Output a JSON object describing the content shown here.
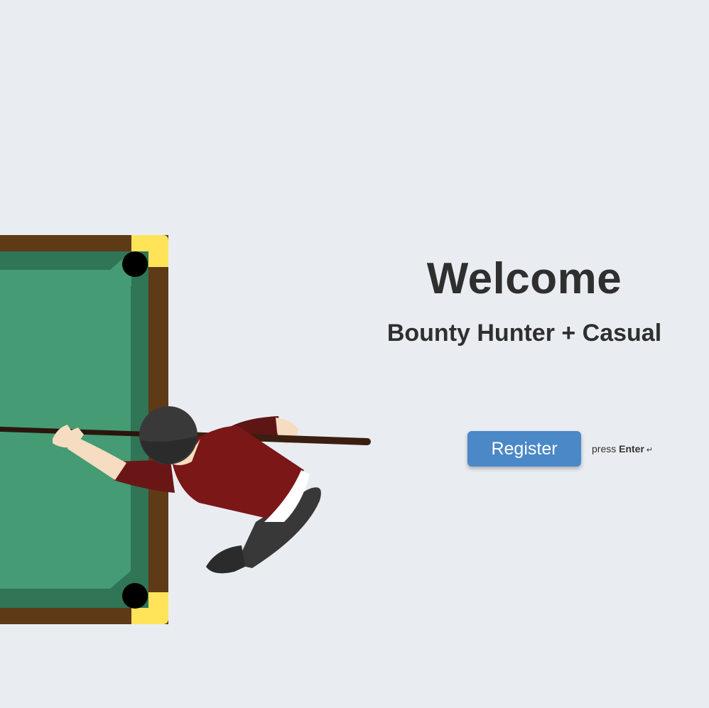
{
  "hero": {
    "title": "Welcome",
    "subtitle": "Bounty Hunter + Casual"
  },
  "actions": {
    "register_label": "Register",
    "hint_prefix": "press",
    "hint_key": "Enter",
    "hint_icon": "return-arrow-icon"
  },
  "colors": {
    "background": "#e9edf2",
    "button": "#4a88c7",
    "table_felt": "#449b74",
    "table_rail": "#5e3a17",
    "table_corner": "#ffe45a",
    "player_shirt": "#7b1717"
  }
}
